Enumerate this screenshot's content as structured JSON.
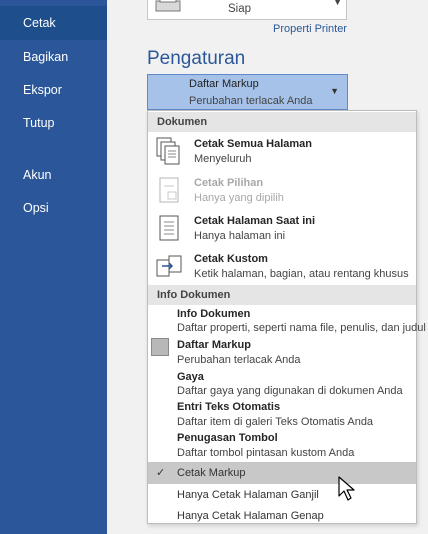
{
  "nav": {
    "items": [
      {
        "label": "Cetak"
      },
      {
        "label": "Bagikan"
      },
      {
        "label": "Ekspor"
      },
      {
        "label": "Tutup"
      },
      {
        "label": "Akun"
      },
      {
        "label": "Opsi"
      }
    ]
  },
  "printer": {
    "status": "Siap",
    "properties_link": "Properti Printer"
  },
  "settings": {
    "title": "Pengaturan",
    "dropdown_title": "Daftar Markup",
    "dropdown_sub": "Perubahan terlacak Anda"
  },
  "menu": {
    "section_document": "Dokumen",
    "document_items": [
      {
        "title": "Cetak Semua Halaman",
        "desc": "Menyeluruh"
      },
      {
        "title": "Cetak Pilihan",
        "desc": "Hanya yang dipilih"
      },
      {
        "title": "Cetak Halaman Saat ini",
        "desc": "Hanya halaman ini"
      },
      {
        "title": "Cetak Kustom",
        "desc": "Ketik halaman, bagian, atau rentang khusus"
      }
    ],
    "section_info": "Info Dokumen",
    "info_items": [
      {
        "title": "Info Dokumen",
        "desc": "Daftar properti, seperti nama file, penulis, dan judul"
      },
      {
        "title": "Daftar Markup",
        "desc": "Perubahan terlacak Anda"
      },
      {
        "title": "Gaya",
        "desc": "Daftar gaya yang digunakan di dokumen Anda"
      },
      {
        "title": "Entri Teks Otomatis",
        "desc": "Daftar item di galeri Teks Otomatis Anda"
      },
      {
        "title": "Penugasan Tombol",
        "desc": "Daftar tombol pintasan kustom Anda"
      }
    ],
    "options": [
      {
        "label": "Cetak Markup",
        "checked": true
      },
      {
        "label": "Hanya Cetak Halaman Ganjil",
        "checked": false
      },
      {
        "label": "Hanya Cetak Halaman Genap",
        "checked": false
      }
    ],
    "check_glyph": "✓"
  },
  "colors": {
    "nav_bg": "#2b579a",
    "accent": "#2b579a",
    "dropdown_bg": "#a6c2e8"
  }
}
